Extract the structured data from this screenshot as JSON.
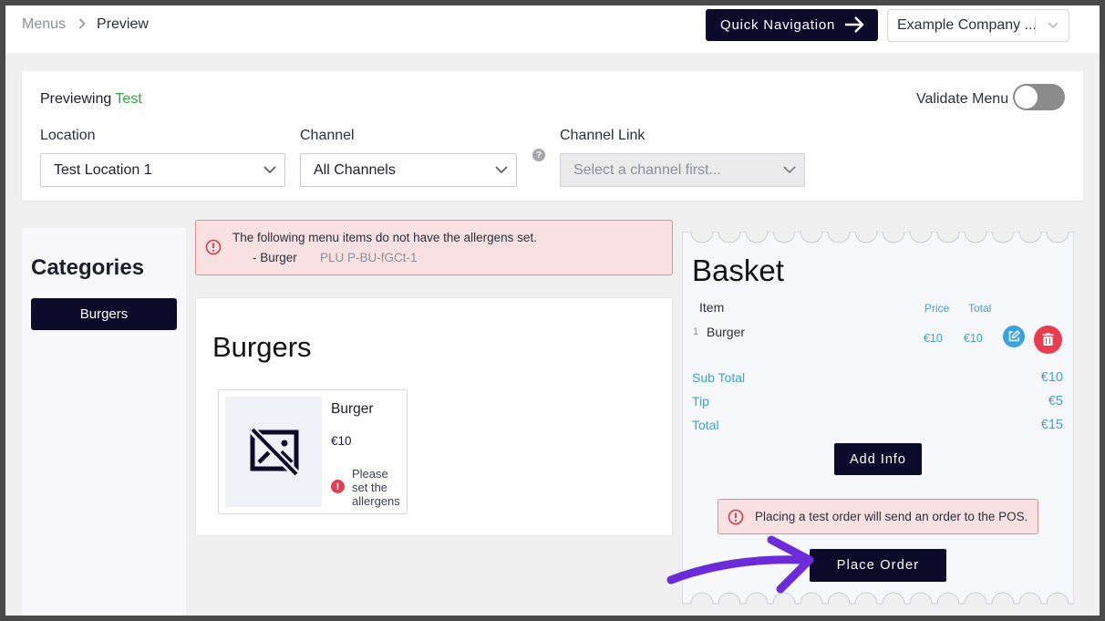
{
  "breadcrumb": {
    "parent": "Menus",
    "current": "Preview"
  },
  "header": {
    "quick_nav_label": "Quick Navigation",
    "company_select_value": "Example Company ..."
  },
  "filters": {
    "previewing_prefix": "Previewing",
    "previewing_name": "Test",
    "validate_label": "Validate Menu",
    "validate_on": false,
    "location_label": "Location",
    "location_value": "Test Location 1",
    "channel_label": "Channel",
    "channel_value": "All Channels",
    "channel_help": "?",
    "channel_link_label": "Channel Link",
    "channel_link_placeholder": "Select a channel first..."
  },
  "categories": {
    "title": "Categories",
    "items": [
      {
        "label": "Burgers"
      }
    ]
  },
  "allergen_alert": {
    "message": "The following menu items do not have the allergens set.",
    "item": "- Burger",
    "plu": "PLU P-BU-fGCt-1"
  },
  "menu_section": {
    "title": "Burgers",
    "items": [
      {
        "name": "Burger",
        "price": "€10",
        "warning": "Please set the allergens",
        "warning_icon": "!"
      }
    ]
  },
  "basket": {
    "title": "Basket",
    "col_item": "Item",
    "col_price": "Price",
    "col_total": "Total",
    "lines": [
      {
        "qty": "1",
        "name": "Burger",
        "price": "€10",
        "total": "€10"
      }
    ],
    "sub_total_label": "Sub Total",
    "sub_total_value": "€10",
    "tip_label": "Tip",
    "tip_value": "€5",
    "total_label": "Total",
    "total_value": "€15",
    "add_info_label": "Add Info",
    "pos_warning": "Placing a test order will send an order to the POS.",
    "place_order_label": "Place Order"
  },
  "colors": {
    "primary_dark": "#0c0b2a",
    "accent_green": "#27ae3d",
    "accent_blue": "#3aa2d8",
    "danger_red": "#e83d50",
    "alert_bg": "#f9e1e1",
    "pointer_purple": "#6b2bd9"
  },
  "icons": [
    "chevron-right-icon",
    "arrow-right-icon",
    "chevron-down-icon",
    "help-icon",
    "alert-circle-icon",
    "no-image-icon",
    "exclamation-icon",
    "edit-icon",
    "trash-icon",
    "pointer-arrow-icon"
  ]
}
